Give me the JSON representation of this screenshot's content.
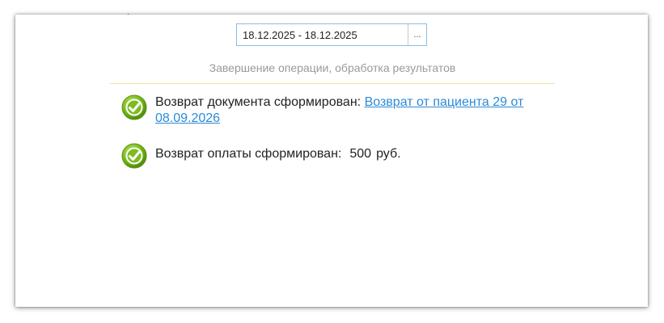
{
  "date_range": {
    "value": "18.12.2025 - 18.12.2025",
    "button_label": "..."
  },
  "status_title": "Завершение операции, обработка результатов",
  "results": {
    "document": {
      "label": "Возврат документа сформирован:",
      "link_text": "Возврат от пациента 29 от 08.09.2026",
      "icon": "check-circle-icon"
    },
    "payment": {
      "label": "Возврат оплаты сформирован:",
      "amount": "500",
      "currency": "руб.",
      "icon": "check-circle-icon"
    }
  },
  "colors": {
    "accent_link": "#2a8ad8",
    "success_green": "#7dbb1e",
    "divider": "#f3e2a8",
    "field_border": "#8cbfe6"
  }
}
